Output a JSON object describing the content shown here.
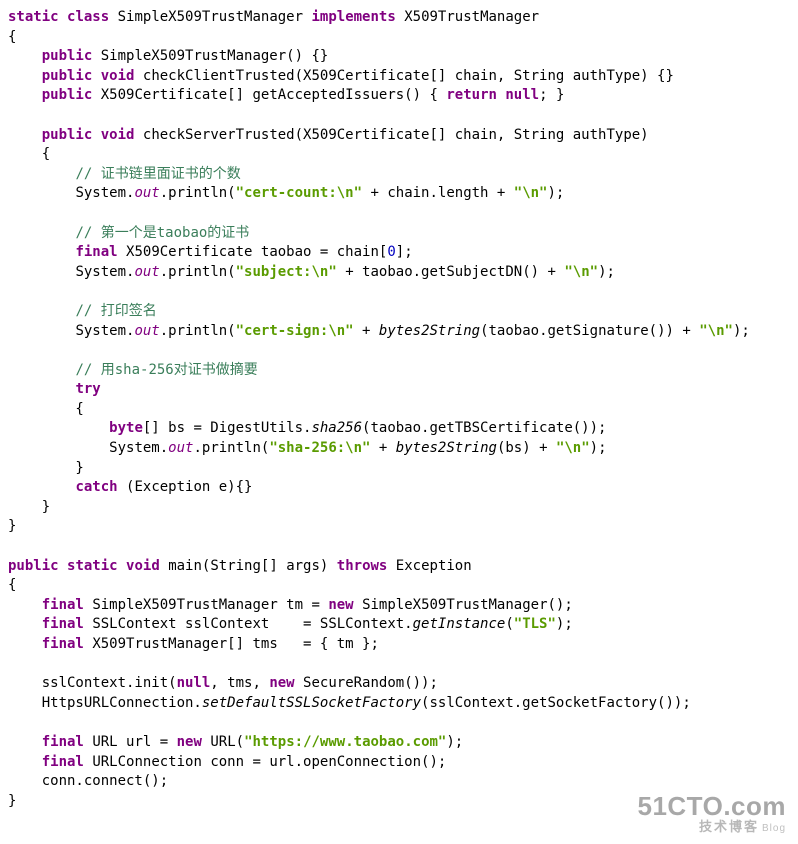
{
  "code": {
    "l1": {
      "kw_static": "static",
      "kw_class": "class",
      "name": "SimpleX509TrustManager",
      "kw_impl": "implements",
      "iface": "X509TrustManager"
    },
    "l3": {
      "kw_public": "public",
      "ctor": "SimpleX509TrustManager() {}"
    },
    "l4": {
      "kw_public": "public",
      "kw_void": "void",
      "sig": "checkClientTrusted(X509Certificate[] chain, String authType) {}"
    },
    "l5": {
      "kw_public": "public",
      "type": "X509Certificate[]",
      "name": "getAcceptedIssuers()",
      "brace_open": "{",
      "kw_return": "return",
      "kw_null": "null",
      "tail": "; }"
    },
    "l7": {
      "kw_public": "public",
      "kw_void": "void",
      "sig": "checkServerTrusted(X509Certificate[] chain, String authType)"
    },
    "c1": "// 证书链里面证书的个数",
    "p1": {
      "head": "System.",
      "out": "out",
      "mid": ".println(",
      "s1": "\"cert-count:\\n\"",
      "plus1": " + chain.length + ",
      "s2": "\"\\n\"",
      "tail": ");"
    },
    "c2": "// 第一个是taobao的证书",
    "p2": {
      "kw_final": "final",
      "decl": "X509Certificate taobao = chain[",
      "idx": "0",
      "tail": "];"
    },
    "p3": {
      "head": "System.",
      "out": "out",
      "mid": ".println(",
      "s1": "\"subject:\\n\"",
      "plus1": " + taobao.getSubjectDN() + ",
      "s2": "\"\\n\"",
      "tail": ");"
    },
    "c3": "// 打印签名",
    "p4": {
      "head": "System.",
      "out": "out",
      "mid": ".println(",
      "s1": "\"cert-sign:\\n\"",
      "plus1": " + ",
      "fn": "bytes2String",
      "arg": "(taobao.getSignature()) + ",
      "s2": "\"\\n\"",
      "tail": ");"
    },
    "c4": "// 用sha-256对证书做摘要",
    "try": "try",
    "p5": {
      "kw_byte": "byte",
      "decl": "[] bs = DigestUtils.",
      "sha": "sha256",
      "arg": "(taobao.getTBSCertificate());"
    },
    "p6": {
      "head": "System.",
      "out": "out",
      "mid": ".println(",
      "s1": "\"sha-256:\\n\"",
      "plus1": " + ",
      "fn": "bytes2String",
      "arg": "(bs) + ",
      "s2": "\"\\n\"",
      "tail": ");"
    },
    "catch": {
      "kw": "catch",
      "sig": "(Exception e){}"
    },
    "main": {
      "kw_public": "public",
      "kw_static": "static",
      "kw_void": "void",
      "name": "main(String[] args)",
      "kw_throws": "throws",
      "exc": "Exception"
    },
    "m1": {
      "kw_final": "final",
      "decl": "SimpleX509TrustManager tm = ",
      "kw_new": "new",
      "tail": "SimpleX509TrustManager();"
    },
    "m2": {
      "kw_final": "final",
      "decl": "SSLContext sslContext    = SSLContext.",
      "gi": "getInstance",
      "open": "(",
      "s": "\"TLS\"",
      "tail": ");"
    },
    "m3": {
      "kw_final": "final",
      "decl": "X509TrustManager[] tms   = { tm };"
    },
    "m4": {
      "head": "sslContext.init(",
      "kw_null": "null",
      "mid": ", tms, ",
      "kw_new": "new",
      "tail": "SecureRandom());"
    },
    "m5": {
      "head": "HttpsURLConnection.",
      "fn": "setDefaultSSLSocketFactory",
      "tail": "(sslContext.getSocketFactory());"
    },
    "m6": {
      "kw_final": "final",
      "decl": "URL url = ",
      "kw_new": "new",
      "cls": "URL(",
      "s": "\"https://www.taobao.com\"",
      "tail": ");"
    },
    "m7": {
      "kw_final": "final",
      "decl": "URLConnection conn = url.openConnection();"
    },
    "m8": "conn.connect();"
  },
  "watermark": {
    "big": "51CTO.com",
    "small": "技术博客",
    "blog": "Blog"
  }
}
